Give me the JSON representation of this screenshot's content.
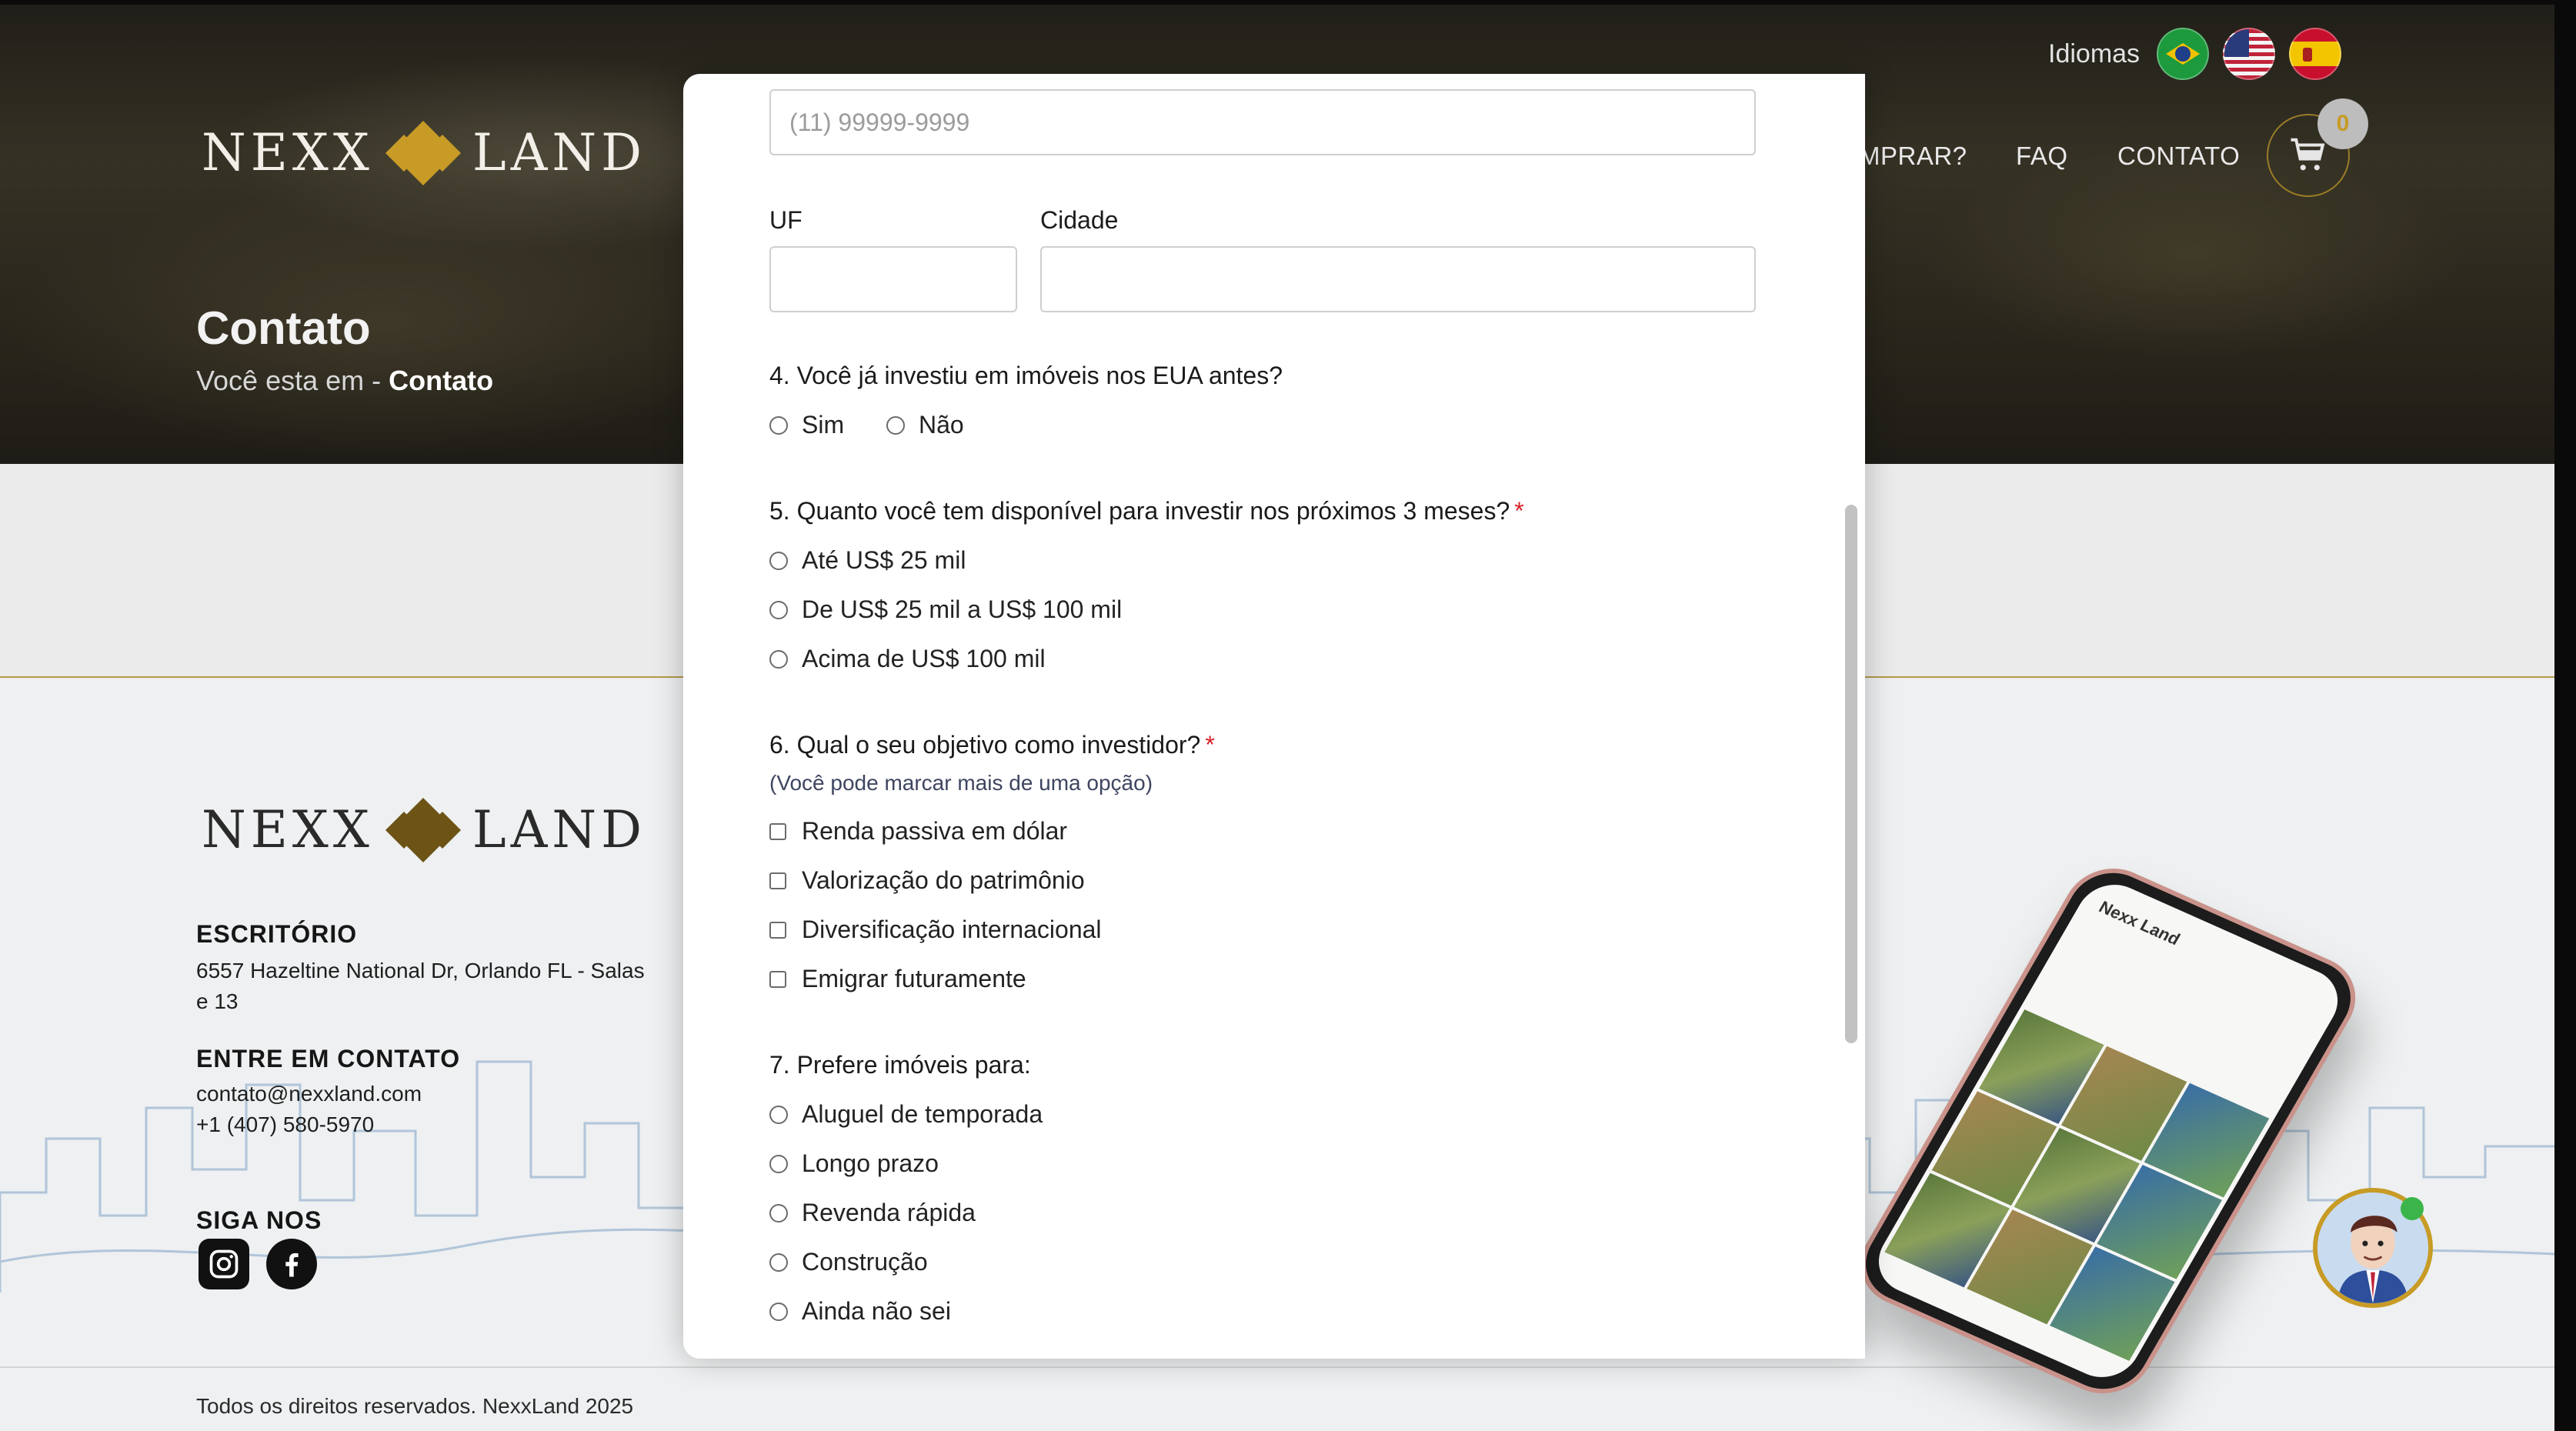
{
  "languages": {
    "label": "Idiomas",
    "flags": [
      "brazil-flag",
      "usa-flag",
      "spain-flag"
    ]
  },
  "header": {
    "logo_left": "NEXX",
    "logo_right": "LAND",
    "nav": [
      "MPRAR?",
      "FAQ",
      "CONTATO"
    ],
    "cart_count": "0"
  },
  "hero": {
    "title": "Contato",
    "breadcrumb_prefix": "Você esta em - ",
    "breadcrumb_current": "Contato"
  },
  "footer": {
    "logo_left": "NEXX",
    "logo_right": "LAND",
    "office_heading": "ESCRITÓRIO",
    "office_line1": "6557 Hazeltine National Dr, Orlando FL - Salas",
    "office_line2": "e 13",
    "contact_heading": "ENTRE EM CONTATO",
    "email": "contato@nexxland.com",
    "phone": "+1 (407) 580-5970",
    "social_heading": "SIGA NOS",
    "copyright": "Todos os direitos reservados. NexxLand 2025"
  },
  "phone_mockup": {
    "title": "Nexx Land",
    "profile": "Nexx Land"
  },
  "form": {
    "phone_placeholder": "(11) 99999-9999",
    "uf_label": "UF",
    "city_label": "Cidade",
    "q4": {
      "question": "4. Você já investiu em imóveis nos EUA antes?",
      "options": [
        "Sim",
        "Não"
      ]
    },
    "q5": {
      "question": "5. Quanto você tem disponível para investir nos próximos 3 meses?",
      "required": "*",
      "options": [
        "Até US$ 25 mil",
        "De US$ 25 mil a US$ 100 mil",
        "Acima de US$ 100 mil"
      ]
    },
    "q6": {
      "question": "6. Qual o seu objetivo como investidor?",
      "required": "*",
      "note": "(Você pode marcar mais de uma opção)",
      "options": [
        "Renda passiva em dólar",
        "Valorização do patrimônio",
        "Diversificação internacional",
        "Emigrar futuramente"
      ]
    },
    "q7": {
      "question": "7. Prefere imóveis para:",
      "options": [
        "Aluguel de temporada",
        "Longo prazo",
        "Revenda rápida",
        "Construção",
        "Ainda não sei"
      ]
    }
  },
  "colors": {
    "gold": "#c79b25",
    "required": "#d81f26",
    "dark": "#111111"
  }
}
